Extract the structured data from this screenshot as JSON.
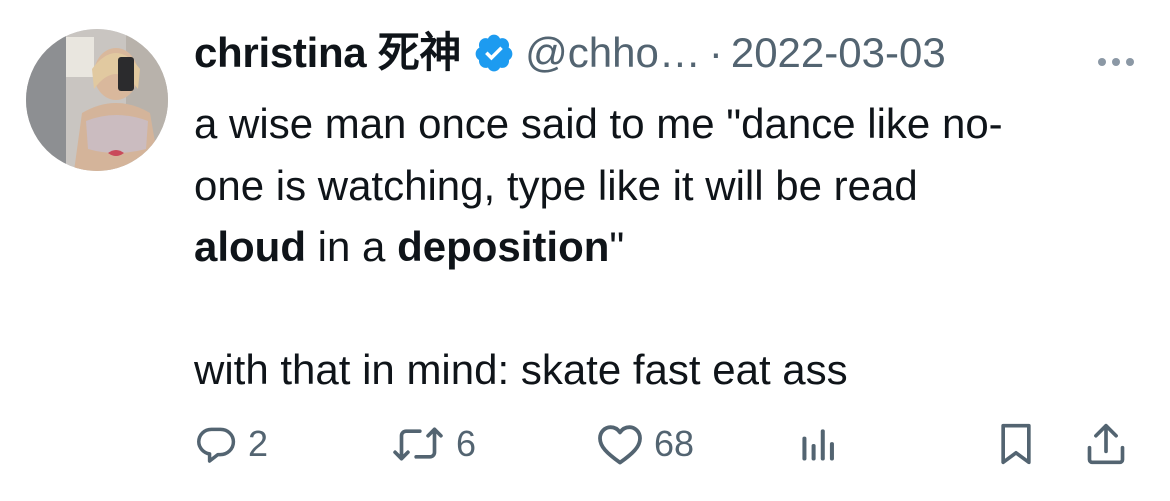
{
  "tweet": {
    "display_name": "christina 死神",
    "handle": "@chho…",
    "separator": "·",
    "date": "2022-03-03",
    "verified": true,
    "body": {
      "line1": "a wise man once said to me \"dance like no-",
      "line2": "one is watching, type like it will be read",
      "line3_bold1": "aloud",
      "line3_mid": " in a ",
      "line3_bold2": "deposition",
      "line3_end": "\"",
      "line5": "with that in mind: skate fast eat ass"
    }
  },
  "actions": {
    "reply_count": "2",
    "retweet_count": "6",
    "like_count": "68"
  },
  "icons": {
    "verified": "verified-badge-icon",
    "more": "more-dots-icon",
    "reply": "reply-icon",
    "retweet": "retweet-icon",
    "like": "heart-icon",
    "views": "analytics-icon",
    "bookmark": "bookmark-icon",
    "share": "share-icon"
  },
  "colors": {
    "text": "#0f1419",
    "secondary": "#536471",
    "verified_blue": "#1d9bf0",
    "background": "#ffffff"
  }
}
